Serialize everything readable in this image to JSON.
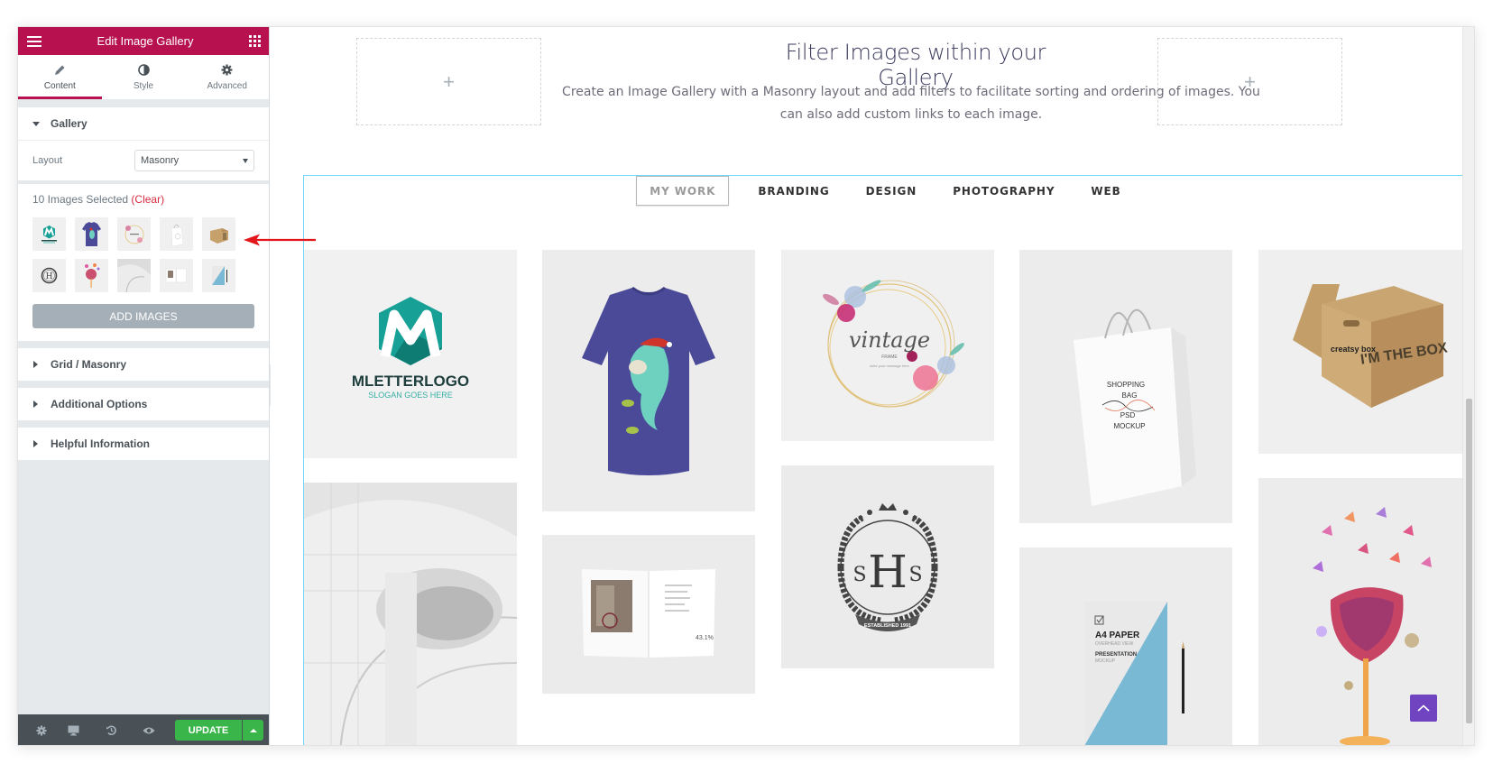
{
  "panel": {
    "title": "Edit Image Gallery",
    "tabs": [
      {
        "label": "Content",
        "icon": "pencil-icon",
        "active": true
      },
      {
        "label": "Style",
        "icon": "half-circle-icon",
        "active": false
      },
      {
        "label": "Advanced",
        "icon": "gear-icon",
        "active": false
      }
    ],
    "gallery_section": {
      "title": "Gallery",
      "layout_label": "Layout",
      "layout_value": "Masonry",
      "selected_text": "10 Images Selected",
      "clear_label": "(Clear)",
      "add_images_label": "ADD IMAGES",
      "thumbnails": [
        "m-letter-logo",
        "purple-tshirt",
        "vintage-frame",
        "shopping-bag",
        "cardboard-box",
        "shs-emblem",
        "watercolor-glass",
        "white-architecture",
        "open-magazine",
        "a4-paper"
      ]
    },
    "sections": [
      {
        "title": "Grid / Masonry"
      },
      {
        "title": "Additional Options"
      },
      {
        "title": "Helpful Information"
      }
    ],
    "footer": {
      "update_label": "UPDATE",
      "icons": [
        "settings-icon",
        "responsive-desktop-icon",
        "history-icon",
        "preview-eye-icon"
      ]
    }
  },
  "preview": {
    "placeholder_plus": "+",
    "title": "Filter Images within your Gallery",
    "description": "Create an Image Gallery with a Masonry layout and add filters to facilitate sorting and ordering of images. You can also add custom links to each image.",
    "filters": [
      {
        "label": "MY WORK",
        "active": true
      },
      {
        "label": "BRANDING",
        "active": false
      },
      {
        "label": "DESIGN",
        "active": false
      },
      {
        "label": "PHOTOGRAPHY",
        "active": false
      },
      {
        "label": "WEB",
        "active": false
      }
    ],
    "images": {
      "mletter": {
        "title": "MLETTERLOGO",
        "slogan": "SLOGAN GOES HERE"
      },
      "vintage": {
        "title": "vintage",
        "sub": "FRAME",
        "tag": "write your message here"
      },
      "bag": {
        "lines": [
          "SHOPPING",
          "BAG",
          "PSD",
          "MOCKUP"
        ]
      },
      "box": {
        "brand": "creatsy box",
        "big": "I'M THE BOX"
      },
      "shs": {
        "mono_left": "S",
        "mono_center": "H",
        "mono_right": "S",
        "banner": "ESTABLISHED 1991"
      },
      "magazine": {
        "stat": "43.1%"
      },
      "paper": {
        "title": "A4 PAPER",
        "sub": "OVERHEAD VIEW",
        "title2": "PRESENTATION",
        "sub2": "MOCKUP"
      }
    }
  },
  "colors": {
    "brand": "#b7124f",
    "update_green": "#39b54a",
    "clear_red": "#d72b3f",
    "gallery_outline": "#71d7f7",
    "to_top": "#7043c1"
  }
}
